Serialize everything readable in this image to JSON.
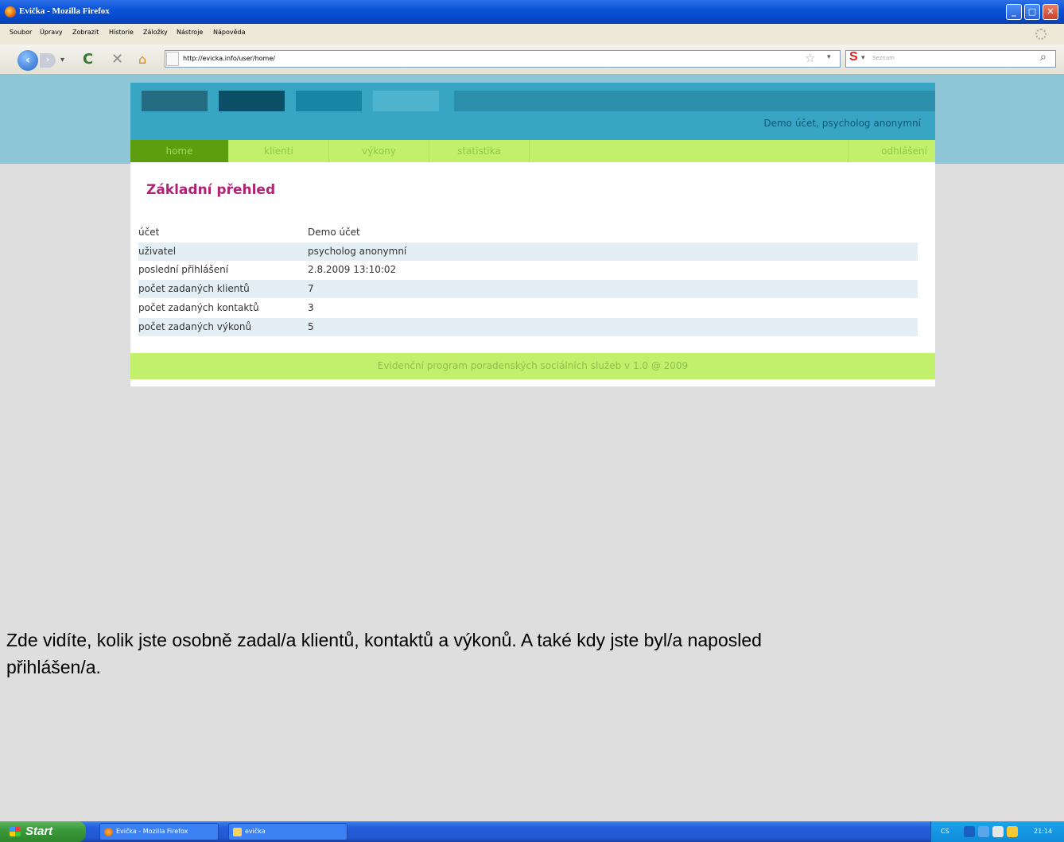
{
  "window": {
    "title": "Evička - Mozilla Firefox",
    "minimize_label": "_",
    "maximize_label": "□",
    "close_label": "✕"
  },
  "menu": [
    "Soubor",
    "Úpravy",
    "Zobrazit",
    "Historie",
    "Záložky",
    "Nástroje",
    "Nápověda"
  ],
  "toolbar": {
    "back_icon": "back-arrow-icon",
    "back_glyph": "‹",
    "forward_glyph": "›",
    "dropdown_glyph": "▾",
    "reload_glyph": "C",
    "stop_glyph": "✕",
    "home_glyph": "⌂",
    "star_glyph": "☆",
    "url": "http://evicka.info/user/home/",
    "search_engine": "S",
    "search_placeholder": "Seznam",
    "search_glyph": "⌕"
  },
  "site": {
    "logo_colors": [
      "#246c82",
      "#0b4f66",
      "#1786a6",
      "#4fb5cf"
    ],
    "user_line": "Demo účet, psycholog anonymní",
    "nav": [
      {
        "label": "home",
        "active": true
      },
      {
        "label": "klienti",
        "active": false
      },
      {
        "label": "výkony",
        "active": false
      },
      {
        "label": "statistika",
        "active": false
      }
    ],
    "logout_label": "odhlášení",
    "page_title": "Základní přehled",
    "rows": [
      {
        "key": "účet",
        "value": "Demo účet"
      },
      {
        "key": "uživatel",
        "value": "psycholog anonymní"
      },
      {
        "key": "poslední přihlášení",
        "value": "2.8.2009 13:10:02"
      },
      {
        "key": "počet zadaných klientů",
        "value": "7"
      },
      {
        "key": "počet zadaných kontaktů",
        "value": "3"
      },
      {
        "key": "počet zadaných výkonů",
        "value": "5"
      }
    ],
    "footer": "Evidenční program poradenských sociálních služeb v 1.0 @ 2009"
  },
  "caption": "Zde vidíte, kolik jste osobně zadal/a klientů, kontaktů a výkonů. A také kdy jste byl/a naposled přihlášen/a.",
  "taskbar": {
    "start_label": "Start",
    "items": [
      "Evička - Mozilla Firefox",
      "evička"
    ],
    "tray_lang": "CS",
    "clock": "21:14"
  }
}
